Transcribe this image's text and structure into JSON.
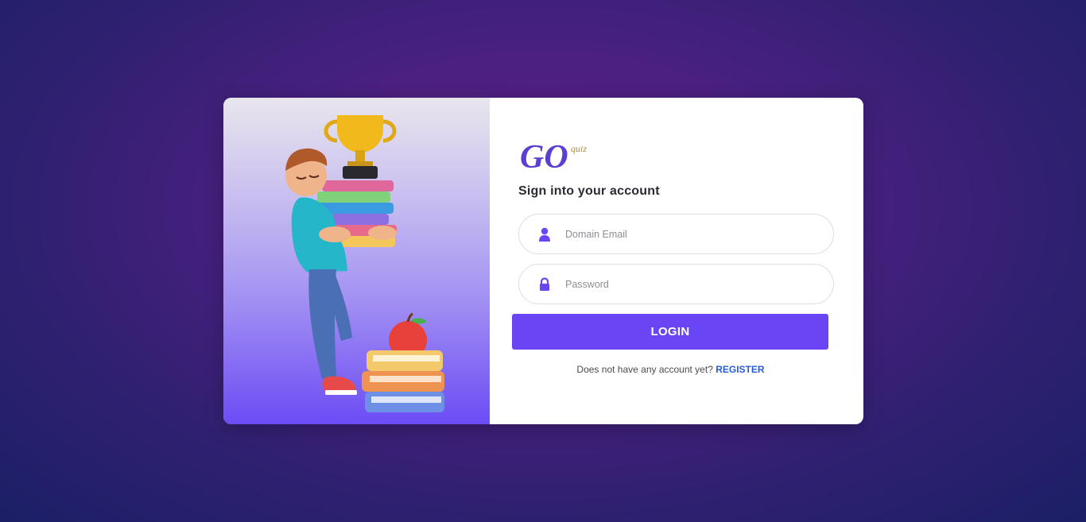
{
  "logo": {
    "text": "GO",
    "subtext": "quiz"
  },
  "form": {
    "heading": "Sign into your account",
    "email": {
      "placeholder": "Domain Email",
      "value": ""
    },
    "password": {
      "placeholder": "Password",
      "value": ""
    },
    "login_label": "LOGIN",
    "register_prompt": "Does not have any account yet?",
    "register_label": "REGISTER"
  },
  "colors": {
    "accent": "#6a45f4",
    "link": "#2a5bd7",
    "background_center": "#5a1f86",
    "background_edge": "#1b1f66"
  },
  "icons": {
    "email": "user-icon",
    "password": "lock-icon"
  }
}
